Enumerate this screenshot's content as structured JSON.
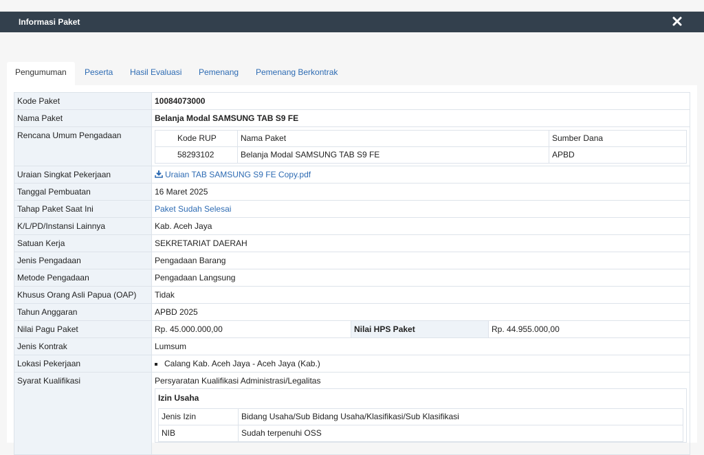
{
  "modal": {
    "title": "Informasi Paket"
  },
  "tabs": [
    "Pengumuman",
    "Peserta",
    "Hasil Evaluasi",
    "Pemenang",
    "Pemenang Berkontrak"
  ],
  "fields": {
    "kode_paket": {
      "label": "Kode Paket",
      "value": "10084073000"
    },
    "nama_paket": {
      "label": "Nama Paket",
      "value": "Belanja Modal SAMSUNG TAB S9 FE"
    },
    "rup": {
      "label": "Rencana Umum Pengadaan",
      "headers": [
        "Kode RUP",
        "Nama Paket",
        "Sumber Dana"
      ],
      "row": [
        "58293102",
        "Belanja Modal SAMSUNG TAB S9 FE",
        "APBD"
      ]
    },
    "uraian": {
      "label": "Uraian Singkat Pekerjaan",
      "value": "Uraian TAB SAMSUNG S9 FE Copy.pdf"
    },
    "tanggal": {
      "label": "Tanggal Pembuatan",
      "value": "16 Maret 2025"
    },
    "tahap": {
      "label": "Tahap Paket Saat Ini",
      "value": "Paket Sudah Selesai"
    },
    "instansi": {
      "label": "K/L/PD/Instansi Lainnya",
      "value": "Kab. Aceh Jaya"
    },
    "satker": {
      "label": "Satuan Kerja",
      "value": "SEKRETARIAT DAERAH"
    },
    "jenis_pengadaan": {
      "label": "Jenis Pengadaan",
      "value": "Pengadaan Barang"
    },
    "metode": {
      "label": "Metode Pengadaan",
      "value": "Pengadaan Langsung"
    },
    "oap": {
      "label": "Khusus Orang Asli Papua (OAP)",
      "value": "Tidak"
    },
    "tahun": {
      "label": "Tahun Anggaran",
      "value": "APBD 2025"
    },
    "pagu": {
      "label": "Nilai Pagu Paket",
      "value": "Rp. 45.000.000,00",
      "hps_label": "Nilai HPS Paket",
      "hps_value": "Rp. 44.955.000,00"
    },
    "kontrak": {
      "label": "Jenis Kontrak",
      "value": "Lumsum"
    },
    "lokasi": {
      "label": "Lokasi Pekerjaan",
      "value": "Calang Kab. Aceh Jaya - Aceh Jaya (Kab.)"
    },
    "syarat": {
      "label": "Syarat Kualifikasi",
      "section": "Persyaratan Kualifikasi Administrasi/Legalitas",
      "box_title": "Izin Usaha",
      "rows": [
        [
          "Jenis Izin",
          "Bidang Usaha/Sub Bidang Usaha/Klasifikasi/Sub Klasifikasi"
        ],
        [
          "NIB",
          "Sudah terpenuhi OSS"
        ]
      ]
    }
  }
}
